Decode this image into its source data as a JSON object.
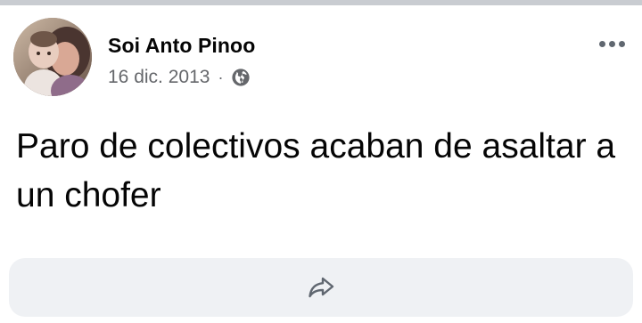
{
  "post": {
    "author": "Soi Anto Pinoo",
    "date": "16 dic. 2013",
    "separator": "·",
    "privacy_icon": "globe-icon",
    "more_icon": "more-options-icon",
    "text": "Paro de colectivos acaban de asaltar a un chofer",
    "share_icon": "share-arrow-icon"
  },
  "colors": {
    "author_text": "#050505",
    "meta_text": "#65676b",
    "share_bar_bg": "#eff1f4",
    "top_strip": "#c9ccd1"
  }
}
